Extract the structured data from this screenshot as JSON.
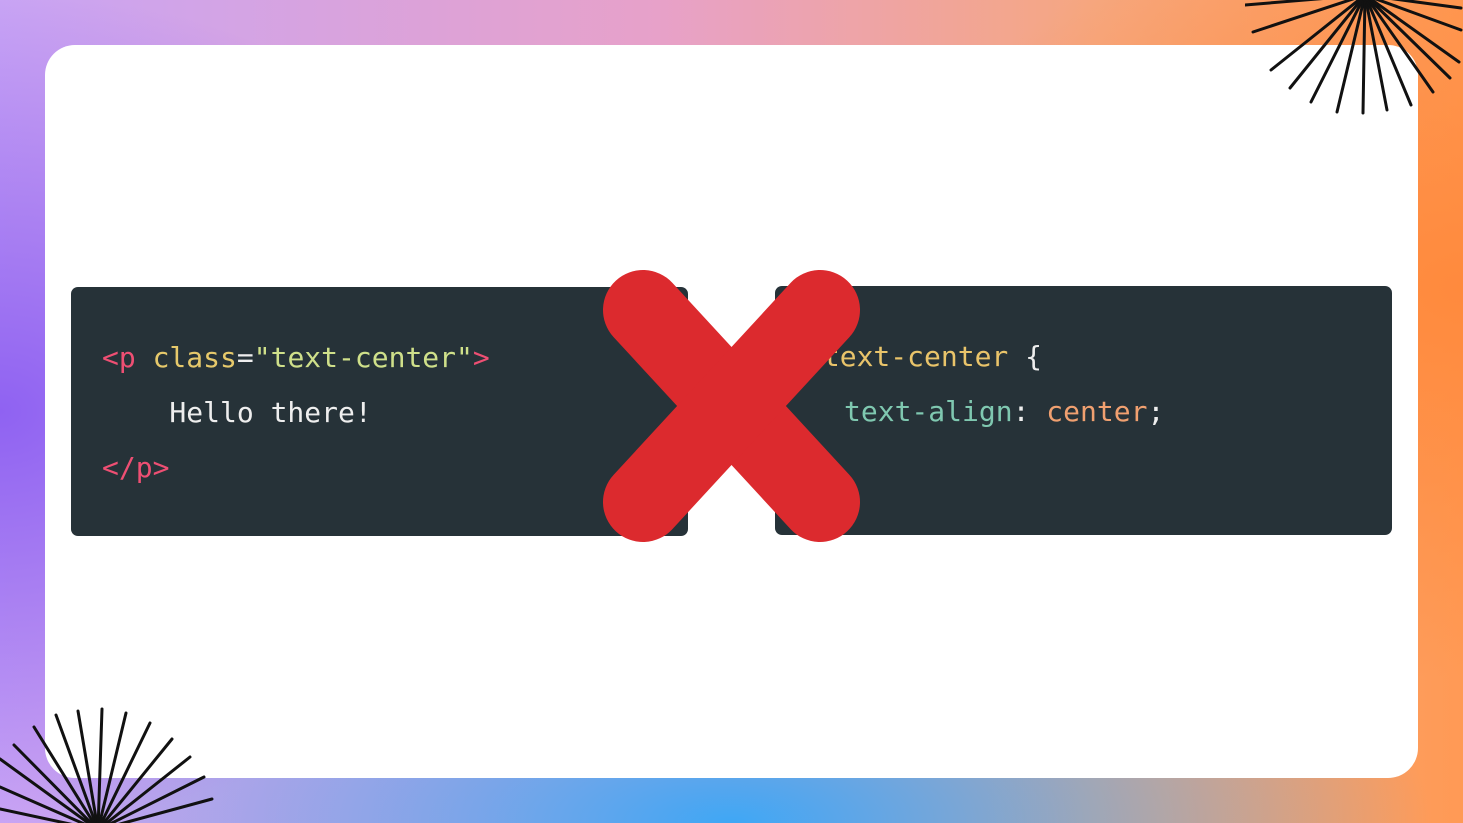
{
  "html_snippet": {
    "line1": {
      "open_bracket": "<p",
      "attr": " class",
      "equals": "=",
      "value": "\"text-center\"",
      "close_bracket": ">"
    },
    "line2": "    Hello there!",
    "line3": "</p>"
  },
  "css_snippet": {
    "line1_selector": ".text-center",
    "line1_brace": " {",
    "line2_property": "text-align",
    "line2_colon": ": ",
    "line2_value": "center",
    "line2_semicolon": ";"
  },
  "overlay": {
    "icon": "cross-icon",
    "color": "#dc2a2e"
  },
  "decorations": {
    "icon": "sunburst-icon",
    "color": "#111111"
  },
  "colors": {
    "card": "#ffffff",
    "code_bg": "#263238"
  }
}
